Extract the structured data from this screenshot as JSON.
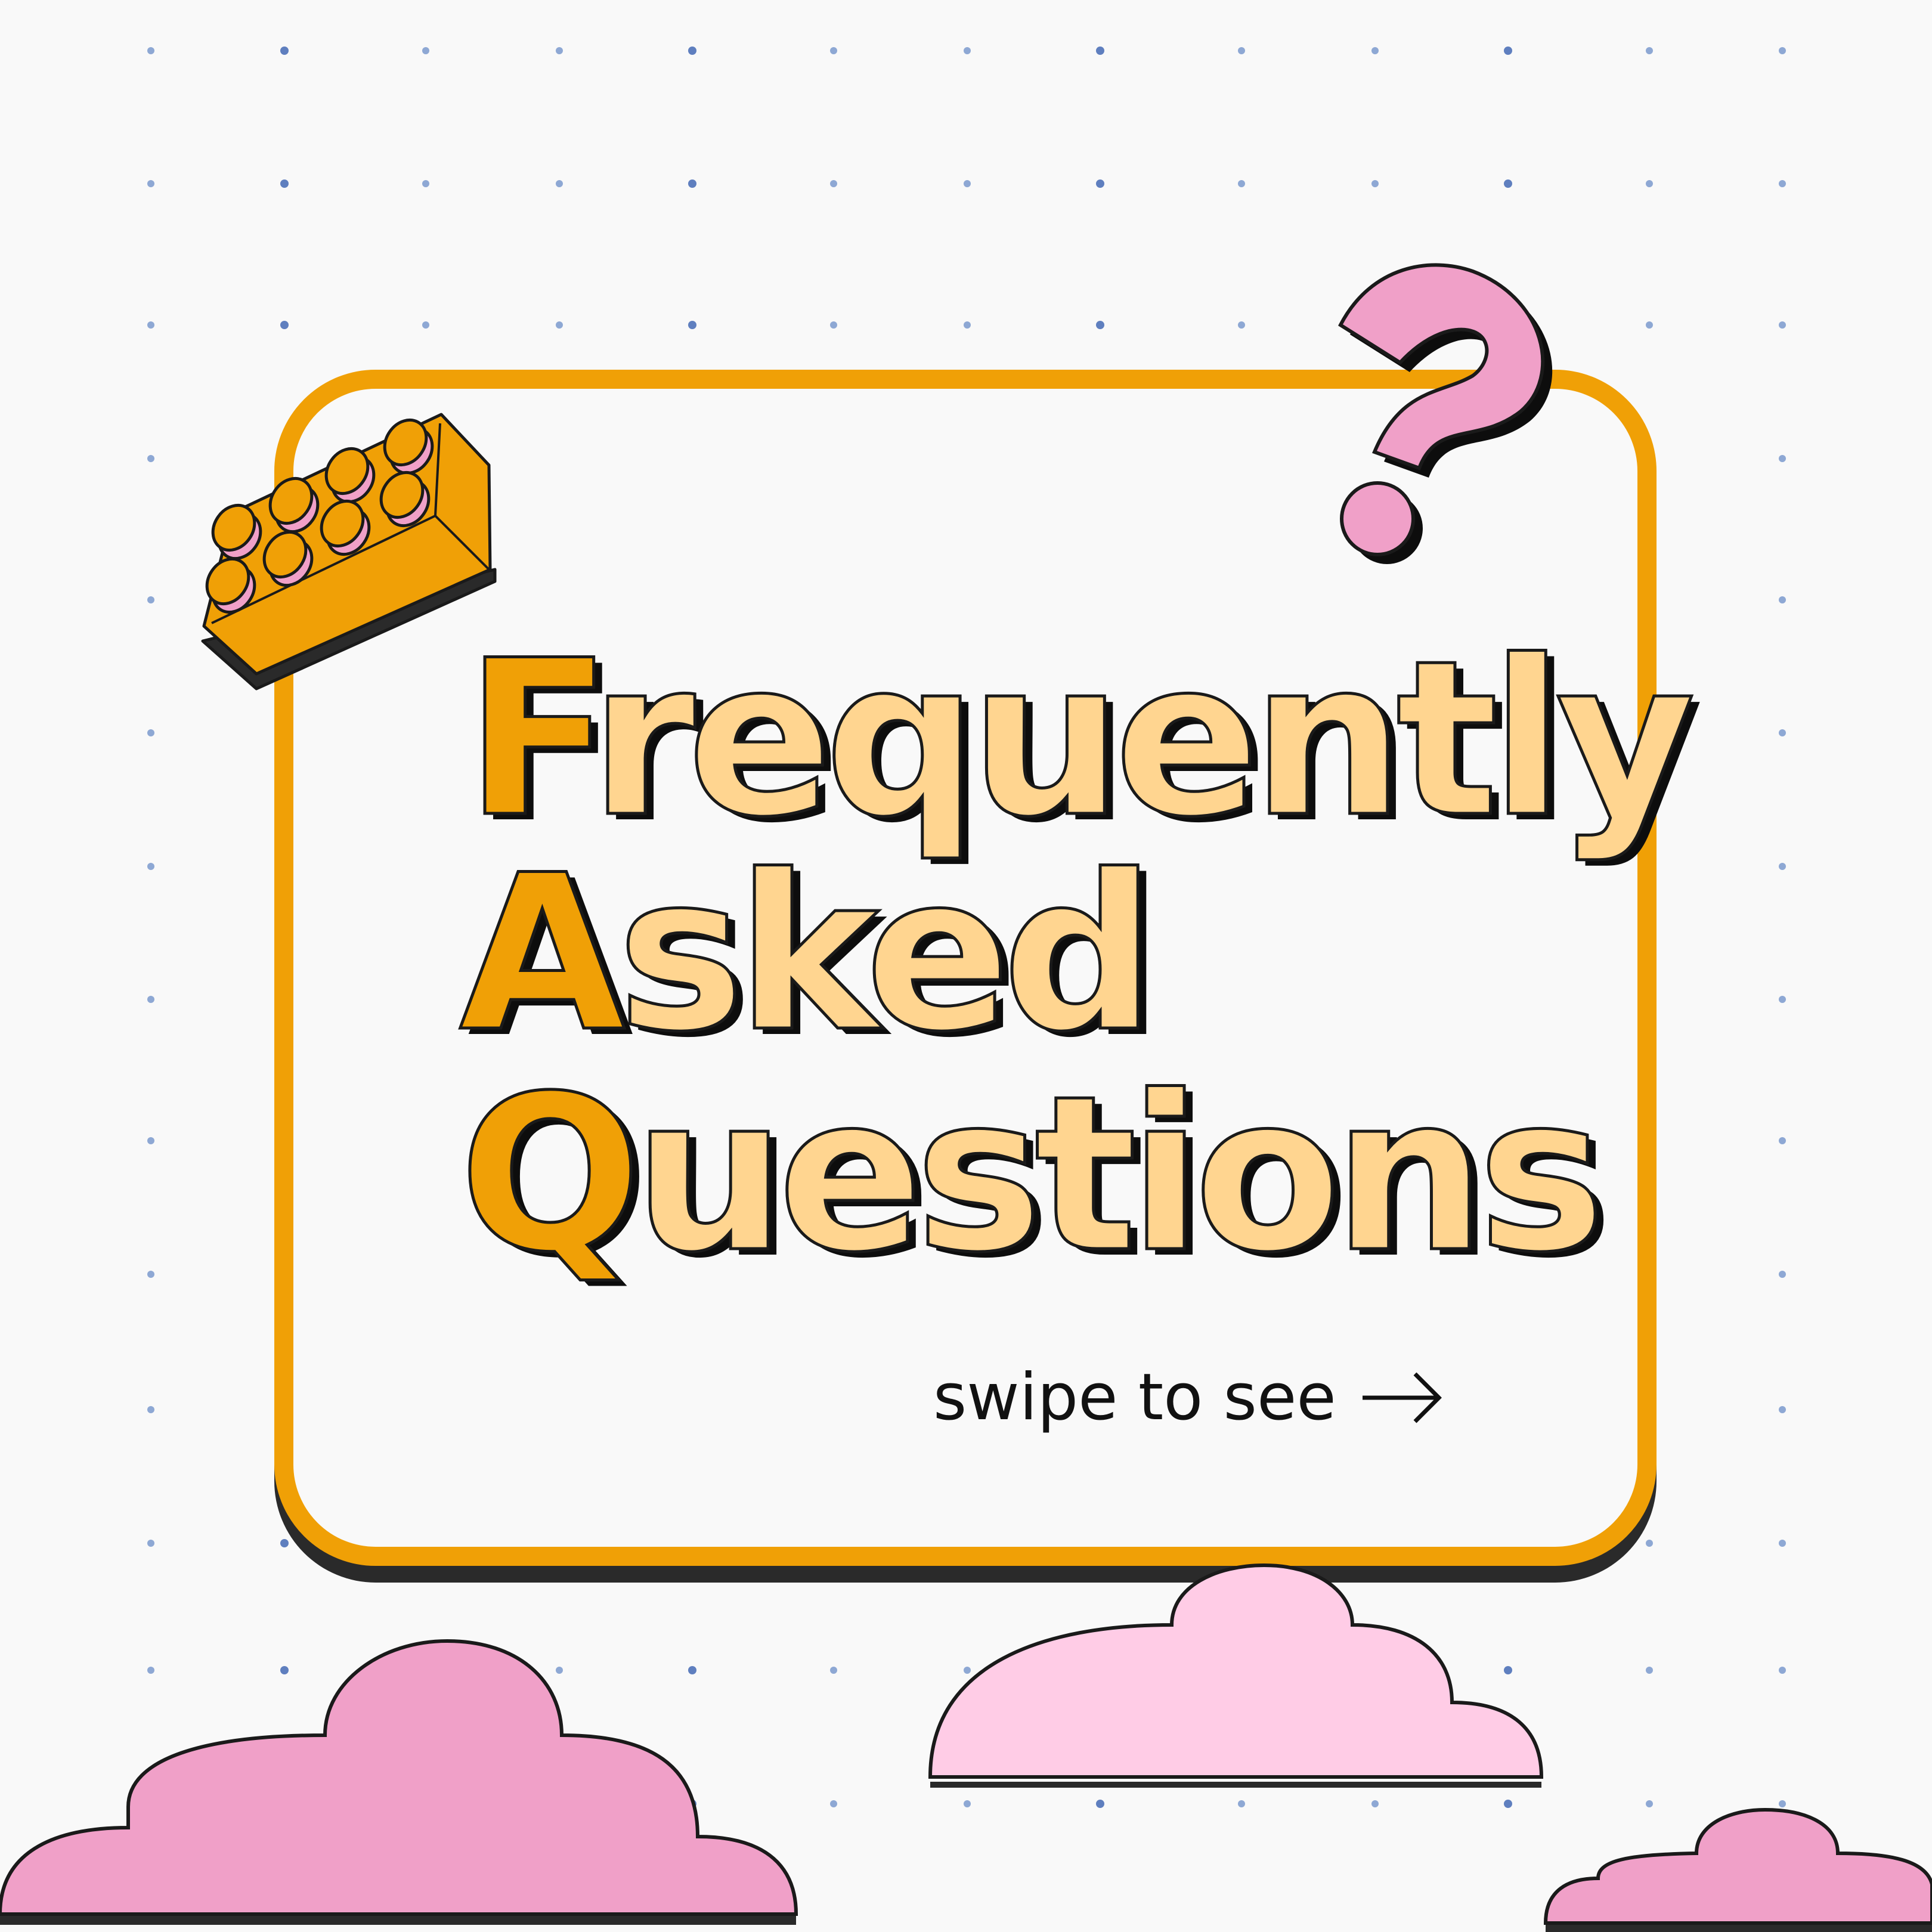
{
  "title": {
    "line1_initial": "F",
    "line1_rest": "requently",
    "line2_initial": "A",
    "line2_rest": "sked",
    "line3_initial": "Q",
    "line3_rest": "uestions"
  },
  "cta": {
    "label": "swipe to see",
    "arrow_icon": "arrow-right-icon"
  },
  "colors": {
    "background": "#f9f9f9",
    "accent_orange": "#f0a006",
    "title_fill": "#ffd590",
    "pink": "#f0a0c8",
    "light_pink": "#ffcce6",
    "dot_blue": "#8ea8d4"
  },
  "decorations": [
    "lego-brick-icon",
    "question-mark-icon",
    "cloud-icon"
  ]
}
